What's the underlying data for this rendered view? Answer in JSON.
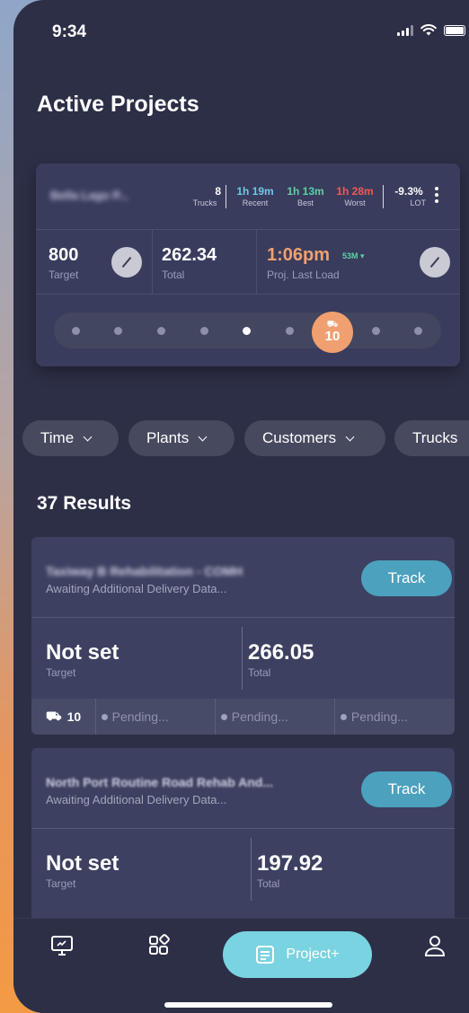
{
  "status": {
    "time": "9:34"
  },
  "page": {
    "title": "Active Projects"
  },
  "active_card": {
    "name": "Bella Lago P...",
    "stats": [
      {
        "value": "8",
        "label": "Trucks",
        "color": "#ffffff"
      },
      {
        "value": "1h 19m",
        "label": "Recent",
        "color": "#6ec8e6"
      },
      {
        "value": "1h 13m",
        "label": "Best",
        "color": "#5fd0a4"
      },
      {
        "value": "1h 28m",
        "label": "Worst",
        "color": "#ef5a55"
      },
      {
        "value": "-9.3%",
        "label": "LOT",
        "color": "#ffffff"
      }
    ],
    "target_value": "800",
    "target_label": "Target",
    "total_value": "262.34",
    "total_label": "Total",
    "proj_time": "1:06pm",
    "proj_delta": "53M",
    "proj_label": "Proj. Last Load",
    "truck_count": "10"
  },
  "filters": [
    "Time",
    "Plants",
    "Customers",
    "Trucks"
  ],
  "results": {
    "label": "37 Results"
  },
  "projects": [
    {
      "name": "Taxiway B Rehabilitation - COMH",
      "status": "Awaiting Additional Delivery Data...",
      "track_label": "Track",
      "target_value": "Not set",
      "target_label": "Target",
      "total_value": "266.05",
      "total_label": "Total",
      "trucks": "10",
      "pending": [
        "Pending...",
        "Pending...",
        "Pending..."
      ]
    },
    {
      "name": "North Port Routine Road Rehab And...",
      "status": "Awaiting Additional Delivery Data...",
      "track_label": "Track",
      "target_value": "Not set",
      "target_label": "Target",
      "total_value": "197.92",
      "total_label": "Total"
    }
  ],
  "tabbar": {
    "project_label": "Project+"
  },
  "colors": {
    "accent_orange": "#f0a070",
    "track_blue": "#4ba1be",
    "project_cyan": "#7ad3e0",
    "background": "#2d2f47"
  }
}
